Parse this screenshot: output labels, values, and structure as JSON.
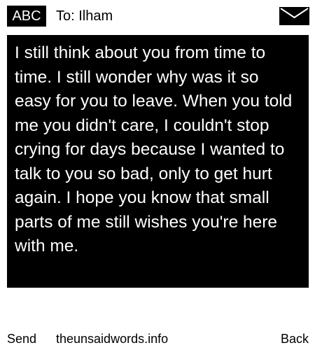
{
  "header": {
    "mode_label": "ABC",
    "recipient": "To: Ilham",
    "envelope_icon": "envelope-icon"
  },
  "message": {
    "body": "I still think about you from time to time. I still wonder why was it so easy for you to leave. When you told me you didn't care, I couldn't stop crying for days because I wanted to talk to you so bad, only to get hurt again. I hope you know that small parts of me still wishes you're here with me."
  },
  "footer": {
    "left_softkey": "Send",
    "site": "theunsaidwords.info",
    "right_softkey": "Back"
  },
  "colors": {
    "background": "#ffffff",
    "message_background": "#000000",
    "message_text": "#ffffff",
    "text": "#000000"
  }
}
